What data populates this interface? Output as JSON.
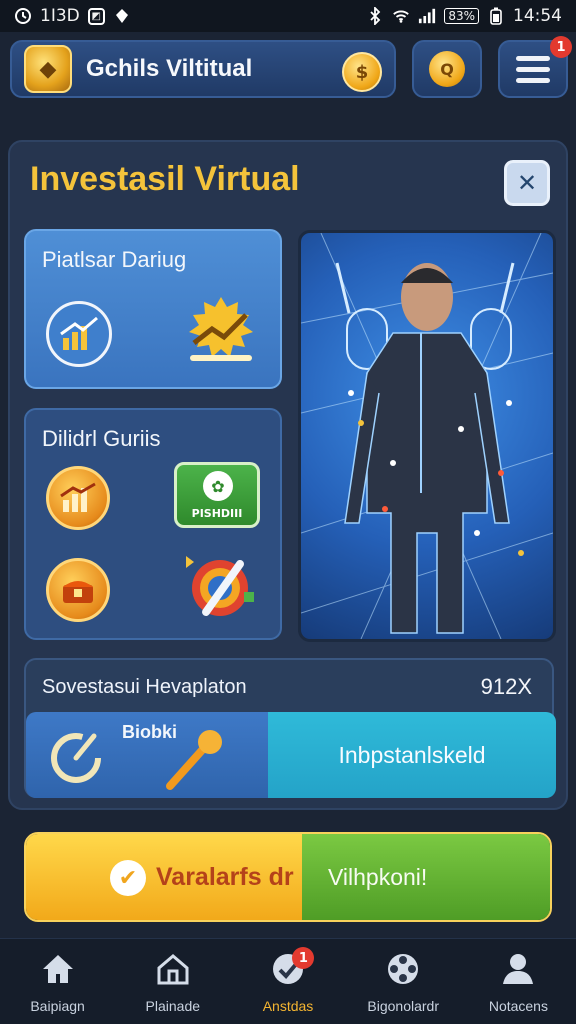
{
  "status_bar": {
    "left_text": "1I3D",
    "time": "14:54",
    "battery_text": "83%"
  },
  "header": {
    "app_title": "Gchils Viltitual",
    "coin_symbol": "$",
    "trophy_symbol": "Q",
    "menu_badge": "1"
  },
  "main": {
    "title": "Investasil Virtual",
    "close_symbol": "✕",
    "tile1": {
      "title": "Piatlsar Dariug"
    },
    "tile2": {
      "title": "Dilidrl Guriis",
      "badge_text": "PISHDIII"
    },
    "investment": {
      "title": "Sovestasui Hevaplaton",
      "count": "912X",
      "left_label": "Biobki",
      "right_label": "Inbpstanlskeld"
    }
  },
  "cta": {
    "left_label": "Varalarfs dr",
    "right_label": "Vilhpkoni!"
  },
  "nav": {
    "items": [
      {
        "label": "Baipiagn",
        "icon": "home-icon"
      },
      {
        "label": "Plainade",
        "icon": "house-outline-icon"
      },
      {
        "label": "Anstdas",
        "icon": "check-target-icon",
        "badge": "1"
      },
      {
        "label": "Bigonolardr",
        "icon": "film-reel-icon"
      },
      {
        "label": "Notacens",
        "icon": "user-icon"
      }
    ]
  },
  "colors": {
    "title_gold": "#f4c33b",
    "card_bg": "#26354f",
    "cta_yellow": "#ffd84a",
    "cta_green": "#7bc942",
    "accent_cyan": "#2fbad9",
    "badge_red": "#e33a2f"
  }
}
